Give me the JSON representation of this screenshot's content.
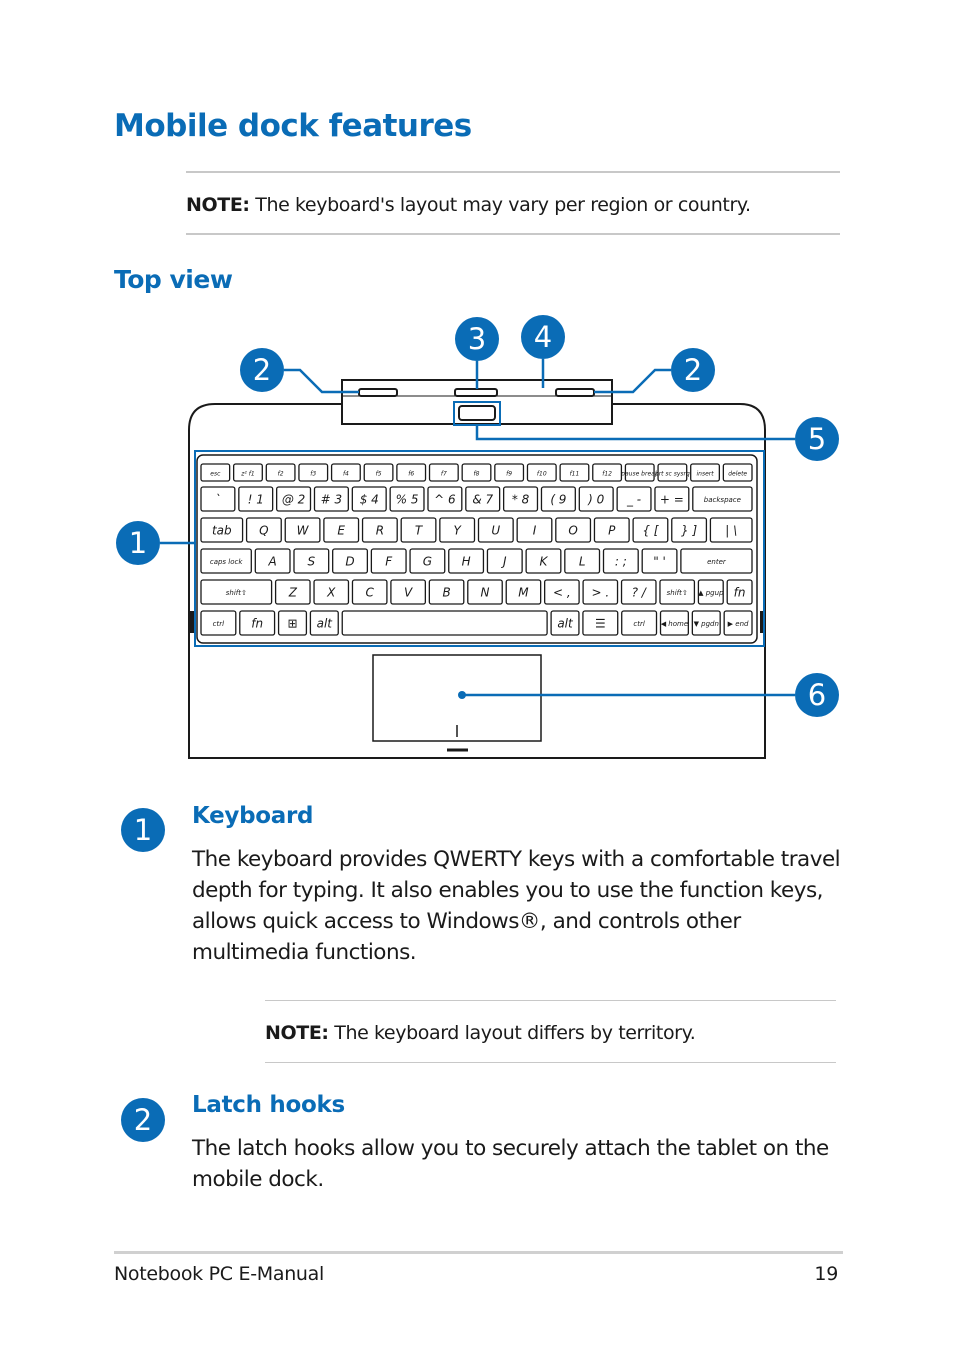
{
  "page": {
    "title": "Mobile dock features",
    "note_top": {
      "label": "NOTE:",
      "text": " The keyboard's layout may vary per region or country."
    },
    "subtitle": "Top view"
  },
  "diagram": {
    "accent": "#0a6cb6",
    "callouts": [
      "1",
      "2",
      "2",
      "3",
      "4",
      "5",
      "6"
    ],
    "keyboard_rows": [
      [
        "esc",
        "z² f1",
        "f2",
        "f3",
        "f4",
        "f5",
        "f6",
        "f7",
        "f8",
        "f9",
        "f10",
        "f11",
        "f12",
        "pause break",
        "prt sc sysrq",
        "insert",
        "delete"
      ],
      [
        "`",
        "! 1",
        "@ 2",
        "# 3",
        "$ 4",
        "% 5",
        "^ 6",
        "& 7",
        "* 8",
        "( 9",
        ") 0",
        "_ -",
        "+ =",
        "backspace"
      ],
      [
        "tab",
        "Q",
        "W",
        "E",
        "R",
        "T",
        "Y",
        "U",
        "I",
        "O",
        "P",
        "{ [",
        "} ]",
        "| \\"
      ],
      [
        "caps lock",
        "A",
        "S",
        "D",
        "F",
        "G",
        "H",
        "J",
        "K",
        "L",
        ": ;",
        "\" '",
        "enter"
      ],
      [
        "shift⇧",
        "Z",
        "X",
        "C",
        "V",
        "B",
        "N",
        "M",
        "< ,",
        "> .",
        "? /",
        "shift⇧",
        "▲ pgup",
        "fn"
      ],
      [
        "ctrl",
        "fn",
        "⊞",
        "alt",
        "",
        "alt",
        "☰",
        "ctrl",
        "◀ home",
        "▼ pgdn",
        "▶ end"
      ]
    ]
  },
  "sections": [
    {
      "number": "1",
      "title": "Keyboard",
      "text": "The keyboard provides QWERTY keys with a comfortable travel depth for typing. It also enables you to use the function keys, allows quick access to Windows®, and controls other multimedia functions.",
      "note": {
        "label": "NOTE:",
        "text": " The keyboard layout differs by territory."
      }
    },
    {
      "number": "2",
      "title": "Latch hooks",
      "text": "The latch hooks allow you to securely attach the tablet on the mobile dock."
    }
  ],
  "footer": {
    "left": "Notebook PC E-Manual",
    "page": "19"
  }
}
